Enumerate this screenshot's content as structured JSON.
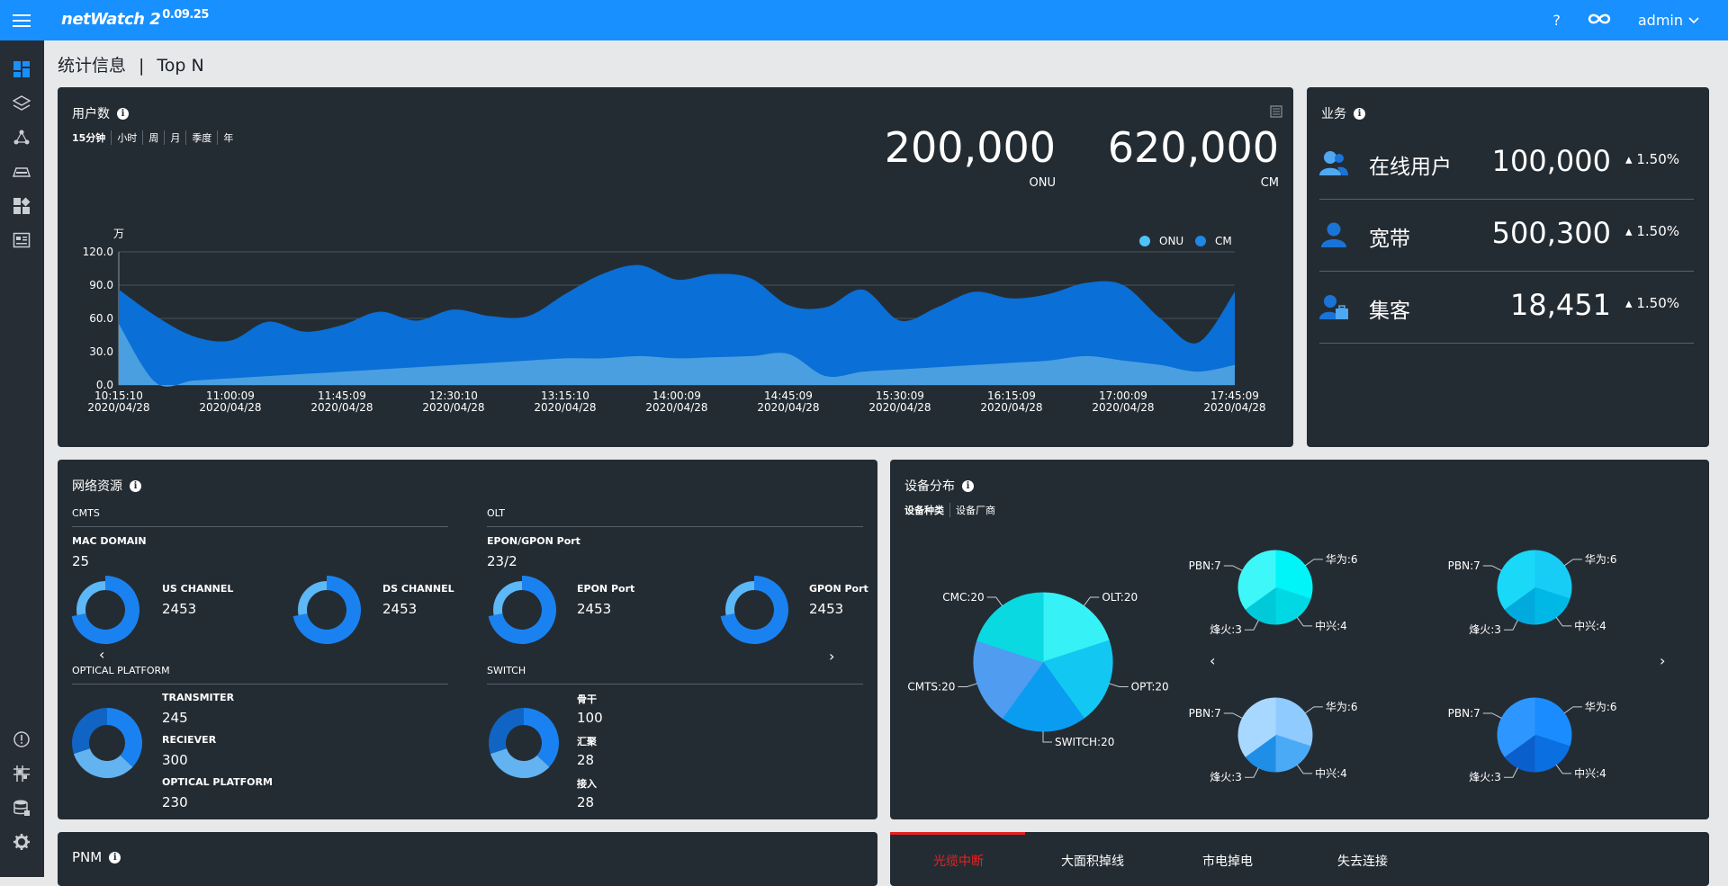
{
  "app": {
    "name": "netWatch 2",
    "version": "0.09.25",
    "help": "?",
    "user": "admin"
  },
  "breadcrumb": {
    "section": "统计信息",
    "separator": "|",
    "page": "Top N"
  },
  "users_panel": {
    "title": "用户数",
    "info": "i",
    "periods": [
      "15分钟",
      "小时",
      "周",
      "月",
      "季度",
      "年"
    ],
    "metrics": [
      {
        "value": "200,000",
        "label": "ONU"
      },
      {
        "value": "620,000",
        "label": "CM"
      }
    ],
    "unit": "万",
    "legend": [
      {
        "name": "ONU",
        "color": "#4fc3f7"
      },
      {
        "name": "CM",
        "color": "#1e88e5"
      }
    ]
  },
  "chart_data": {
    "type": "area",
    "ylabel": "万",
    "ylim": [
      0,
      120
    ],
    "yticks": [
      "120.0",
      "90.0",
      "60.0",
      "30.0",
      "0.0"
    ],
    "x_ticks": [
      {
        "time": "10:15:10",
        "date": "2020/04/28"
      },
      {
        "time": "11:00:09",
        "date": "2020/04/28"
      },
      {
        "time": "11:45:09",
        "date": "2020/04/28"
      },
      {
        "time": "12:30:10",
        "date": "2020/04/28"
      },
      {
        "time": "13:15:10",
        "date": "2020/04/28"
      },
      {
        "time": "14:00:09",
        "date": "2020/04/28"
      },
      {
        "time": "14:45:09",
        "date": "2020/04/28"
      },
      {
        "time": "15:30:09",
        "date": "2020/04/28"
      },
      {
        "time": "16:15:09",
        "date": "2020/04/28"
      },
      {
        "time": "17:00:09",
        "date": "2020/04/28"
      },
      {
        "time": "17:45:09",
        "date": "2020/04/28"
      }
    ],
    "series": [
      {
        "name": "CM",
        "color": "#0a6fd6",
        "values": [
          86,
          62,
          44,
          40,
          57,
          48,
          54,
          66,
          58,
          68,
          62,
          62,
          82,
          100,
          108,
          95,
          100,
          96,
          72,
          70,
          86,
          58,
          70,
          84,
          78,
          82,
          92,
          90,
          60,
          38,
          84
        ]
      },
      {
        "name": "ONU",
        "color": "#4a9fe0",
        "values": [
          55,
          2,
          4,
          6,
          8,
          10,
          12,
          14,
          16,
          18,
          20,
          22,
          24,
          24,
          26,
          24,
          25,
          26,
          28,
          8,
          12,
          14,
          16,
          18,
          20,
          22,
          26,
          22,
          18,
          12,
          18
        ]
      }
    ]
  },
  "business_panel": {
    "title": "业务",
    "info": "i",
    "rows": [
      {
        "name": "在线用户",
        "value": "100,000",
        "pct": "1.50%",
        "icon": "users-icon"
      },
      {
        "name": "宽带",
        "value": "500,300",
        "pct": "1.50%",
        "icon": "user-icon"
      },
      {
        "name": "集客",
        "value": "18,451",
        "pct": "1.50%",
        "icon": "enterprise-user-icon"
      }
    ]
  },
  "network_panel": {
    "title": "网络资源",
    "info": "i",
    "cmts": {
      "title": "CMTS",
      "sub": "MAC DOMAIN",
      "sub_value": "25",
      "items": [
        {
          "label": "US CHANNEL",
          "value": "2453",
          "pct": 0.72
        },
        {
          "label": "DS CHANNEL",
          "value": "2453",
          "pct": 0.72
        }
      ]
    },
    "olt": {
      "title": "OLT",
      "sub": "EPON/GPON Port",
      "sub_value": "23/2",
      "items": [
        {
          "label": "EPON Port",
          "value": "2453",
          "pct": 0.72
        },
        {
          "label": "GPON Port",
          "value": "2453",
          "pct": 0.72
        }
      ]
    },
    "optical": {
      "title": "OPTICAL PLATFORM",
      "items": [
        {
          "label": "TRANSMITER",
          "value": "245"
        },
        {
          "label": "RECIEVER",
          "value": "300"
        },
        {
          "label": "OPTICAL PLATFORM",
          "value": "230"
        }
      ]
    },
    "switch": {
      "title": "SWITCH",
      "items": [
        {
          "label": "骨干",
          "value": "100"
        },
        {
          "label": "汇聚",
          "value": "28"
        },
        {
          "label": "接入",
          "value": "28"
        }
      ]
    },
    "prev": "‹",
    "next": "›"
  },
  "device_panel": {
    "title": "设备分布",
    "info": "i",
    "tabs": [
      "设备种类",
      "设备厂商"
    ],
    "main_pie": [
      {
        "name": "OLT",
        "value": 20,
        "label": "OLT:20",
        "color": "#36f1f6"
      },
      {
        "name": "OPT",
        "value": 20,
        "label": "OPT:20",
        "color": "#12c8f2"
      },
      {
        "name": "SWITCH",
        "value": 20,
        "label": "SWITCH:20",
        "color": "#0a9cf0"
      },
      {
        "name": "CMTS",
        "value": 20,
        "label": "CMTS:20",
        "color": "#4f9cf0"
      },
      {
        "name": "CMC",
        "value": 20,
        "label": "CMC:20",
        "color": "#0bd9e1"
      }
    ],
    "small_labels": [
      "华为:6",
      "中兴:4",
      "烽火:3",
      "PBN:7"
    ],
    "small_values": [
      6,
      4,
      3,
      7
    ],
    "small_colors": [
      [
        "#00f5f8",
        "#00d8e4",
        "#00c9da",
        "#3df7f9"
      ],
      [
        "#17cdf5",
        "#00b8e6",
        "#00aadd",
        "#1ad8f7"
      ],
      [
        "#8fcbff",
        "#4aaaf5",
        "#1f8ee6",
        "#a8d8ff"
      ],
      [
        "#1a8cff",
        "#0a6fe0",
        "#0a5fcc",
        "#2e97ff"
      ]
    ],
    "prev": "‹",
    "next": "›"
  },
  "pnm_panel": {
    "title": "PNM",
    "info": "i"
  },
  "alarm_tabs": [
    "光缆中断",
    "大面积掉线",
    "市电掉电",
    "失去连接"
  ]
}
